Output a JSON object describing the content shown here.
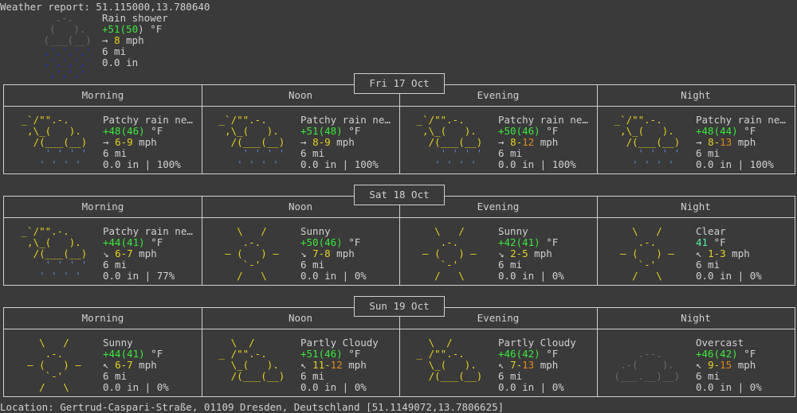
{
  "header": {
    "title": "Weather report: 51.115000,13.780640",
    "condition": "Rain shower",
    "temp_pre": "+51(",
    "temp_feel": "50",
    "temp_post": ") °F",
    "wind_arrow": "→ ",
    "wind": "8",
    "wind_unit": " mph",
    "visibility": "6 mi",
    "precip": "0.0 in"
  },
  "days": [
    {
      "label": "Fri 17 Oct",
      "periods": [
        {
          "name": "Morning",
          "desc": "Patchy rain ne…",
          "temp": "+48",
          "feel": "46",
          "arrow": "→ ",
          "w1": "6-9",
          "w2": "",
          "vis": "6 mi",
          "precip": "0.0 in | 100%"
        },
        {
          "name": "Noon",
          "desc": "Patchy rain ne…",
          "temp": "+51",
          "feel": "48",
          "arrow": "→ ",
          "w1": "8-9",
          "w2": "",
          "vis": "6 mi",
          "precip": "0.0 in | 100%"
        },
        {
          "name": "Evening",
          "desc": "Patchy rain ne…",
          "temp": "+50",
          "feel": "46",
          "arrow": "→ ",
          "w1": "8-",
          "w2": "12",
          "vis": "6 mi",
          "precip": "0.0 in | 100%"
        },
        {
          "name": "Night",
          "desc": "Patchy rain ne…",
          "temp": "+48",
          "feel": "44",
          "arrow": "→ ",
          "w1": "8-",
          "w2": "13",
          "vis": "6 mi",
          "precip": "0.0 in | 100%"
        }
      ]
    },
    {
      "label": "Sat 18 Oct",
      "periods": [
        {
          "name": "Morning",
          "desc": "Patchy rain ne…",
          "temp": "+44",
          "feel": "41",
          "arrow": "↘ ",
          "w1": "6-7",
          "w2": "",
          "vis": "6 mi",
          "precip": "0.0 in | 77%"
        },
        {
          "name": "Noon",
          "desc": "Sunny",
          "temp": "+50",
          "feel": "46",
          "arrow": "↘ ",
          "w1": "7-8",
          "w2": "",
          "vis": "6 mi",
          "precip": "0.0 in | 0%"
        },
        {
          "name": "Evening",
          "desc": "Sunny",
          "temp": "+42",
          "feel": "41",
          "arrow": "↘ ",
          "w1": "2-5",
          "w2": "",
          "vis": "6 mi",
          "precip": "0.0 in | 0%"
        },
        {
          "name": "Night",
          "desc": "Clear",
          "temp": "",
          "feel": "41",
          "arrow": "↖ ",
          "w1": "1-3",
          "w2": "",
          "vis": "6 mi",
          "precip": "0.0 in | 0%"
        }
      ]
    },
    {
      "label": "Sun 19 Oct",
      "periods": [
        {
          "name": "Morning",
          "desc": "Sunny",
          "temp": "+44",
          "feel": "41",
          "arrow": "↖ ",
          "w1": "6-7",
          "w2": "",
          "vis": "6 mi",
          "precip": "0.0 in | 0%"
        },
        {
          "name": "Noon",
          "desc": "Partly Cloudy",
          "temp": "+51",
          "feel": "46",
          "arrow": "↖ ",
          "w1": "11-",
          "w2": "12",
          "vis": "6 mi",
          "precip": "0.0 in | 0%"
        },
        {
          "name": "Evening",
          "desc": "Partly Cloudy",
          "temp": "+46",
          "feel": "42",
          "arrow": "↖ ",
          "w1": "7-",
          "w2": "13",
          "vis": "6 mi",
          "precip": "0.0 in | 0%"
        },
        {
          "name": "Night",
          "desc": "Overcast",
          "temp": "+46",
          "feel": "42",
          "arrow": "↖ ",
          "w1": "9-",
          "w2": "15",
          "vis": "6 mi",
          "precip": "0.0 in | 0%"
        }
      ]
    }
  ],
  "location": "Location: Gertrud-Caspari-Straße, 01109 Dresden, Deutschland [51.1149072,13.7806625]",
  "icons": [
    "rain-shower-icon",
    "patchy-rain-icon",
    "sunny-icon",
    "clear-icon",
    "partly-cloudy-icon",
    "overcast-icon"
  ]
}
